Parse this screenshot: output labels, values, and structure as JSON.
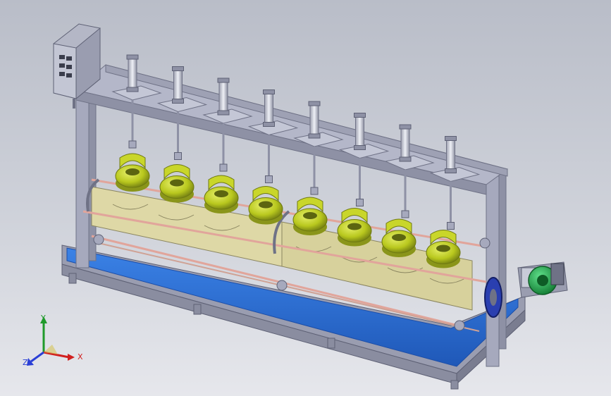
{
  "viewport": {
    "background_top": "#b9bdc8",
    "background_bottom": "#e6e7ec"
  },
  "model": {
    "colors": {
      "frame": "#a6a9bd",
      "frame_dark": "#6f7286",
      "tray": "#2f6fd6",
      "tray_dark": "#1c4ea8",
      "bottle_yellow": "#c9d62a",
      "bottle_dark": "#6f7a12",
      "guide": "#ded8a6",
      "cylinder": "#d8dae4",
      "motor_green": "#1fa84a",
      "cabinet": "#b4b7c6"
    },
    "stations": 8
  },
  "triad": {
    "x_label": "X",
    "y_label": "Y",
    "z_label": "Z",
    "colors": {
      "x": "#d11f1f",
      "y": "#1f9a2a",
      "z": "#2a3fd6"
    }
  }
}
